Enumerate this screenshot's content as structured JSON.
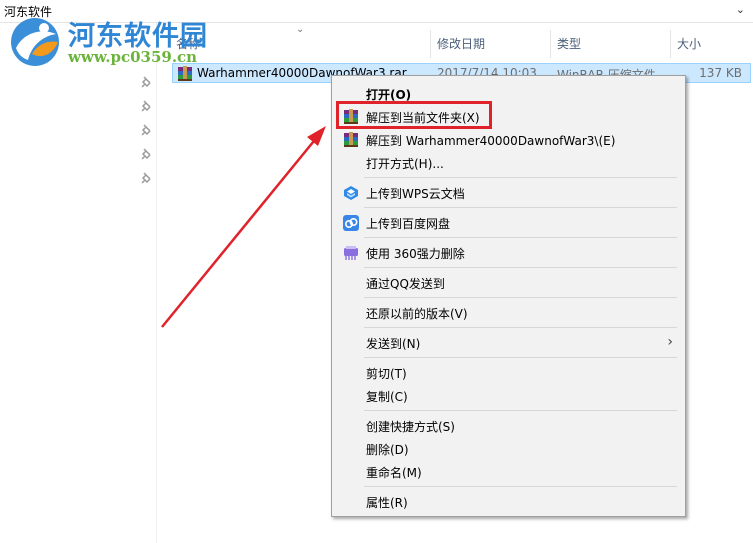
{
  "address_bar": {
    "path": "河东软件"
  },
  "watermark": {
    "title": "河东软件园",
    "url": "www.pc0359.cn"
  },
  "columns": [
    {
      "label": "名称"
    },
    {
      "label": "修改日期"
    },
    {
      "label": "类型"
    },
    {
      "label": "大小"
    }
  ],
  "file": {
    "name": "Warhammer40000DawnofWar3.rar",
    "date": "2017/7/14 10:03",
    "type": "WinRAR 压缩文件",
    "size": "137 KB"
  },
  "context_menu": {
    "items": [
      {
        "label": "打开(O)",
        "icon": "none",
        "bold": true
      },
      {
        "label": "解压到当前文件夹(X)",
        "icon": "winrar-icon"
      },
      {
        "label": "解压到 Warhammer40000DawnofWar3\\(E)",
        "icon": "winrar-icon"
      },
      {
        "label": "打开方式(H)...",
        "icon": "none"
      },
      {
        "label": "上传到WPS云文档",
        "icon": "wps-cloud-icon"
      },
      {
        "label": "上传到百度网盘",
        "icon": "baidu-netdisk-icon"
      },
      {
        "label": "使用 360强力删除",
        "icon": "360-shred-icon"
      },
      {
        "label": "通过QQ发送到",
        "icon": "none"
      },
      {
        "label": "还原以前的版本(V)",
        "icon": "none"
      },
      {
        "label": "发送到(N)",
        "icon": "none",
        "submenu": true
      },
      {
        "label": "剪切(T)",
        "icon": "none"
      },
      {
        "label": "复制(C)",
        "icon": "none"
      },
      {
        "label": "创建快捷方式(S)",
        "icon": "none"
      },
      {
        "label": "删除(D)",
        "icon": "none"
      },
      {
        "label": "重命名(M)",
        "icon": "none"
      },
      {
        "label": "属性(R)",
        "icon": "none"
      }
    ]
  },
  "colors": {
    "selection": "#cce8ff",
    "highlight": "#e0222a",
    "watermark_blue": "#2f86d4",
    "watermark_green": "#6ab43c"
  }
}
